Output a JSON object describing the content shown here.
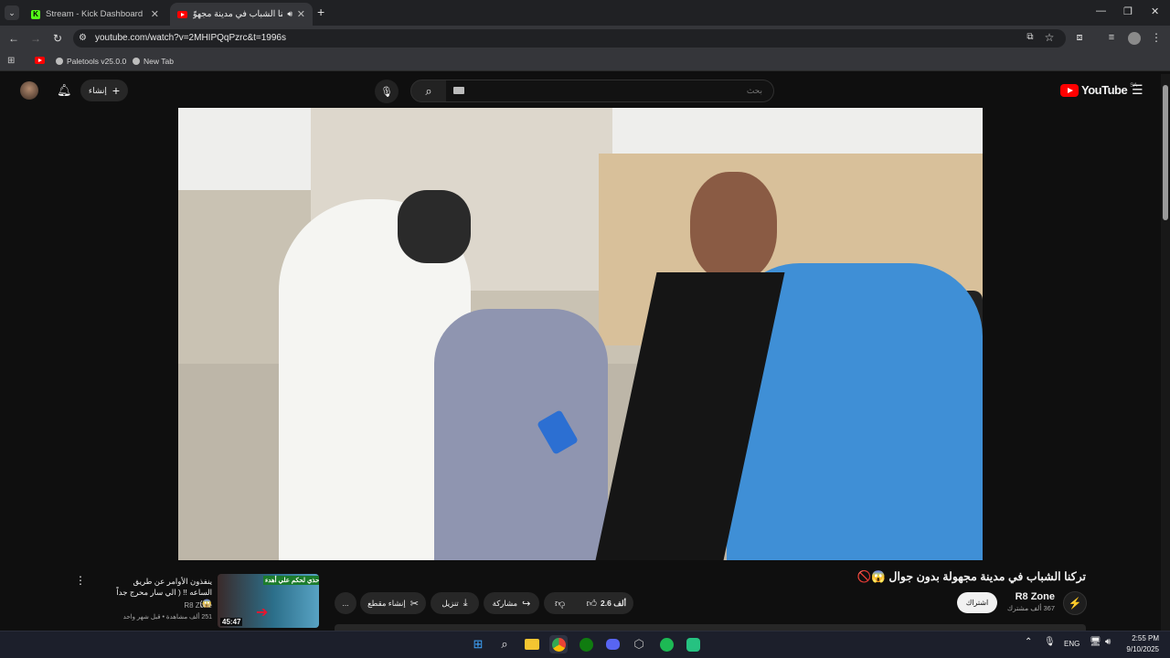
{
  "browser": {
    "tabs": [
      {
        "title": "Stream - Kick Dashboard"
      },
      {
        "title": "تركنا الشباب في مدينة مجهوّ"
      }
    ],
    "url": "youtube.com/watch?v=2MHIPQqPzrc&t=1996s",
    "bookmarks": [
      {
        "label": ""
      },
      {
        "label": "Paletools v25.0.0"
      },
      {
        "label": "New Tab"
      }
    ]
  },
  "youtube": {
    "create_label": "إنشاء",
    "search_placeholder": "بحث",
    "logo_text": "YouTube",
    "region": "SA"
  },
  "video": {
    "title": "تركنا الشباب في مدينة مجهولة بدون جوال 😱🚫",
    "channel": "R8 Zone",
    "subscribers": "367 ألف مشترك",
    "subscribe_label": "اشتراك",
    "likes": "2.6 ألف",
    "share_label": "مشاركة",
    "download_label": "تنزيل",
    "clip_label": "إنشاء مقطع",
    "more_label": "..."
  },
  "next_video": {
    "title": "ينفذون الأوامر عن طريق الساعه !! ( الي سار محرج جداً 😱)",
    "channel": "R8 Zone",
    "meta": "251 ألف مشاهدة • قبل شهر واحد",
    "duration": "45:47",
    "thumb_text": "احذي لحكم علي أهدء!!"
  },
  "taskbar": {
    "lang": "ENG",
    "time": "2:55 PM",
    "date": "9/10/2025"
  }
}
